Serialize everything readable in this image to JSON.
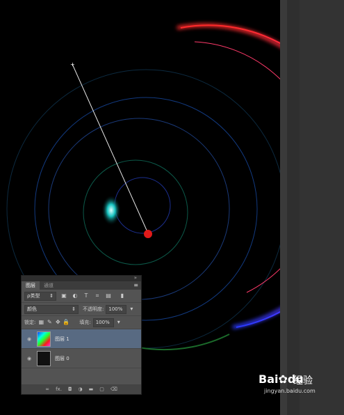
{
  "panel": {
    "tabs": [
      "图层",
      "通道"
    ],
    "menu_icon": "≡",
    "collapse_icon": "»",
    "filter_kind": "ρ类型",
    "filter_icons": [
      "image-filter-icon",
      "adjustment-filter-icon",
      "type-filter-icon",
      "shape-filter-icon",
      "smart-filter-icon"
    ],
    "blend_mode": "颜色",
    "opacity_label": "不透明度:",
    "opacity_value": "100%",
    "lock_label": "锁定:",
    "fill_label": "填充:",
    "fill_value": "100%",
    "layers": [
      {
        "name": "图层 1",
        "selected": true
      },
      {
        "name": "图层 0",
        "selected": false
      }
    ],
    "bottom_icons": [
      "link-icon",
      "fx-icon",
      "mask-icon",
      "adjustment-icon",
      "folder-icon",
      "new-layer-icon",
      "trash-icon"
    ]
  },
  "watermark": {
    "brand": "Bai",
    "brand2": "du",
    "cn": "经验",
    "url": "jingyan.baidu.com"
  },
  "colors": {
    "canvas_bg": "#000000",
    "panel_bg": "#535353",
    "selected_layer": "#586a82"
  }
}
